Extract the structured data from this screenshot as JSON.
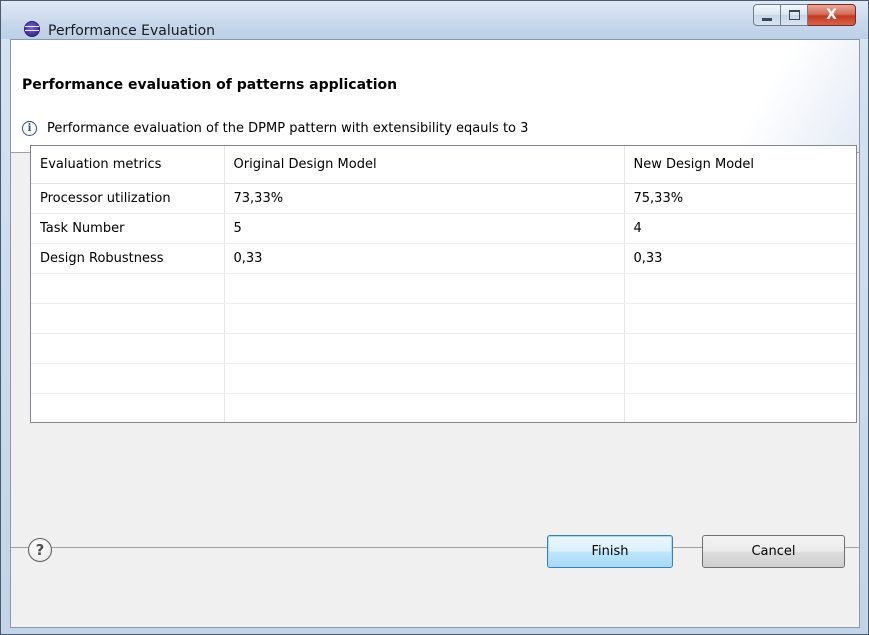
{
  "window": {
    "title": "Performance Evaluation",
    "close_glyph": "X"
  },
  "header": {
    "title": "Performance evaluation of patterns application",
    "info_glyph": "i",
    "message": "Performance evaluation of the DPMP pattern with extensibility eqauls to 3"
  },
  "table": {
    "columns": [
      "Evaluation metrics",
      "Original Design Model",
      "New Design Model"
    ],
    "rows": [
      [
        "Processor utilization",
        "73,33%",
        "75,33%"
      ],
      [
        "Task Number",
        "5",
        "4"
      ],
      [
        "Design Robustness",
        "0,33",
        "0,33"
      ]
    ]
  },
  "footer": {
    "help_glyph": "?",
    "finish_label": "Finish",
    "cancel_label": "Cancel"
  },
  "icons": {
    "app": "eclipse-icon",
    "info": "info-icon",
    "help": "help-icon"
  },
  "colors": {
    "finish_border": "#3c7fb1",
    "close_red": "#c43a21",
    "titlebar": "#c9d9ec"
  }
}
